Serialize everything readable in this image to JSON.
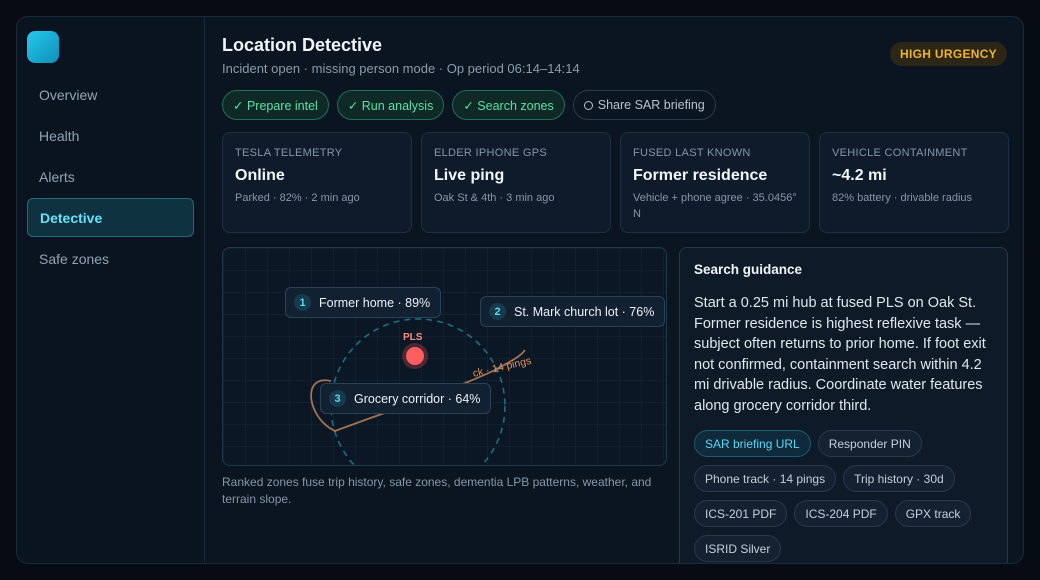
{
  "sidebar": {
    "items": [
      {
        "label": "Overview"
      },
      {
        "label": "Health"
      },
      {
        "label": "Alerts"
      },
      {
        "label": "Detective"
      },
      {
        "label": "Safe zones"
      }
    ],
    "active": "Detective"
  },
  "header": {
    "title": "Location Detective",
    "subtitle": "Incident open · missing person mode · Op period 06:14–14:14",
    "urgency": "HIGH URGENCY"
  },
  "actions": [
    {
      "label": "✓ Prepare intel"
    },
    {
      "label": "✓ Run analysis"
    },
    {
      "label": "✓ Search zones"
    },
    {
      "label": "Share SAR briefing"
    }
  ],
  "cards": [
    {
      "label": "TESLA TELEMETRY",
      "value": "Online",
      "sub": "Parked · 82% · 2 min ago"
    },
    {
      "label": "ELDER IPHONE GPS",
      "value": "Live ping",
      "sub": "Oak St & 4th · 3 min ago"
    },
    {
      "label": "FUSED LAST KNOWN",
      "value": "Former residence",
      "sub": "Vehicle + phone agree · 35.0456° N"
    },
    {
      "label": "VEHICLE CONTAINMENT",
      "value": "~4.2 mi",
      "sub": "82% battery · drivable radius"
    }
  ],
  "map": {
    "pls_label": "PLS",
    "track_label": "ck · 14 pings",
    "zones": [
      {
        "num": "1",
        "label": "Former home · 89%"
      },
      {
        "num": "2",
        "label": "St. Mark church lot · 76%"
      },
      {
        "num": "3",
        "label": "Grocery corridor · 64%"
      }
    ],
    "caption": "Ranked zones fuse trip history, safe zones, dementia LPB patterns, weather, and terrain slope."
  },
  "guidance": {
    "title": "Search guidance",
    "text": "Start a 0.25 mi hub at fused PLS on Oak St. Former residence is highest reflexive task — subject often returns to prior home. If foot exit not confirmed, containment search within 4.2 mi drivable radius. Coordinate water features along grocery corridor third.",
    "chips": [
      {
        "label": "SAR briefing URL"
      },
      {
        "label": "Responder PIN"
      },
      {
        "label": "Phone track · 14 pings"
      },
      {
        "label": "Trip history · 30d"
      },
      {
        "label": "ICS-201 PDF"
      },
      {
        "label": "ICS-204 PDF"
      },
      {
        "label": "GPX track"
      },
      {
        "label": "ISRID Silver"
      }
    ]
  },
  "colors": {
    "accent": "#5cd6f6",
    "success": "#58e0a8",
    "urgency": "#f0b429",
    "pls": "#ff5e5e",
    "track": "#e2925a"
  }
}
